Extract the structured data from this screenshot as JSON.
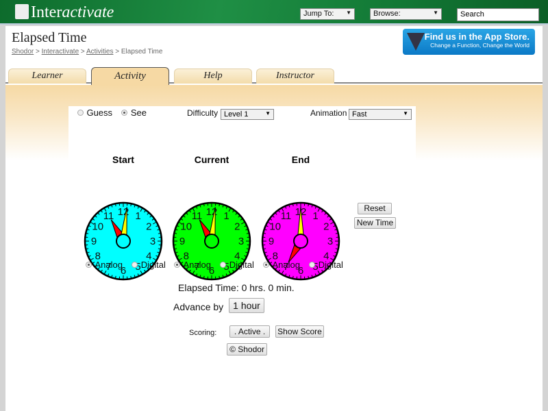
{
  "header": {
    "logo_prefix": "Inter",
    "logo_suffix": "activate",
    "jump_to": "Jump To:",
    "browse": "Browse:",
    "search_placeholder": "Search"
  },
  "page": {
    "title": "Elapsed Time",
    "breadcrumbs": [
      "Shodor",
      "Interactivate",
      "Activities",
      "Elapsed Time"
    ],
    "separator": ">"
  },
  "app_store": {
    "line1": "Find us in the App Store.",
    "line2": "Change a Function, Change the World"
  },
  "tabs": [
    {
      "label": "Learner"
    },
    {
      "label": "Activity",
      "active": true
    },
    {
      "label": "Help"
    },
    {
      "label": "Instructor"
    }
  ],
  "controls": {
    "mode_guess": "Guess",
    "mode_see": "See",
    "selected_mode": "See",
    "difficulty_label": "Difficulty",
    "difficulty": "Level 1",
    "animation_label": "Animation",
    "animation": "Fast"
  },
  "clocks": [
    {
      "title": "Start",
      "color": "#00ffff",
      "hour": 11,
      "minute": 1,
      "analog": "Analog",
      "digital": "Digital",
      "mode": "Analog"
    },
    {
      "title": "Current",
      "color": "#00ff00",
      "hour": 11,
      "minute": 1,
      "analog": "Analog",
      "digital": "Digital",
      "mode": "Analog"
    },
    {
      "title": "End",
      "color": "#ff00ff",
      "hour": 7,
      "minute": 0,
      "analog": "Analog",
      "digital": "Digital",
      "mode": "Analog"
    }
  ],
  "buttons": {
    "reset": "Reset",
    "new_time": "New Time",
    "advance": "1 hour",
    "active": ". Active .",
    "show_score": "Show Score",
    "shodor": "© Shodor"
  },
  "elapsed": "Elapsed Time: 0 hrs. 0 min.",
  "advance_label": "Advance by",
  "scoring_label": "Scoring:"
}
